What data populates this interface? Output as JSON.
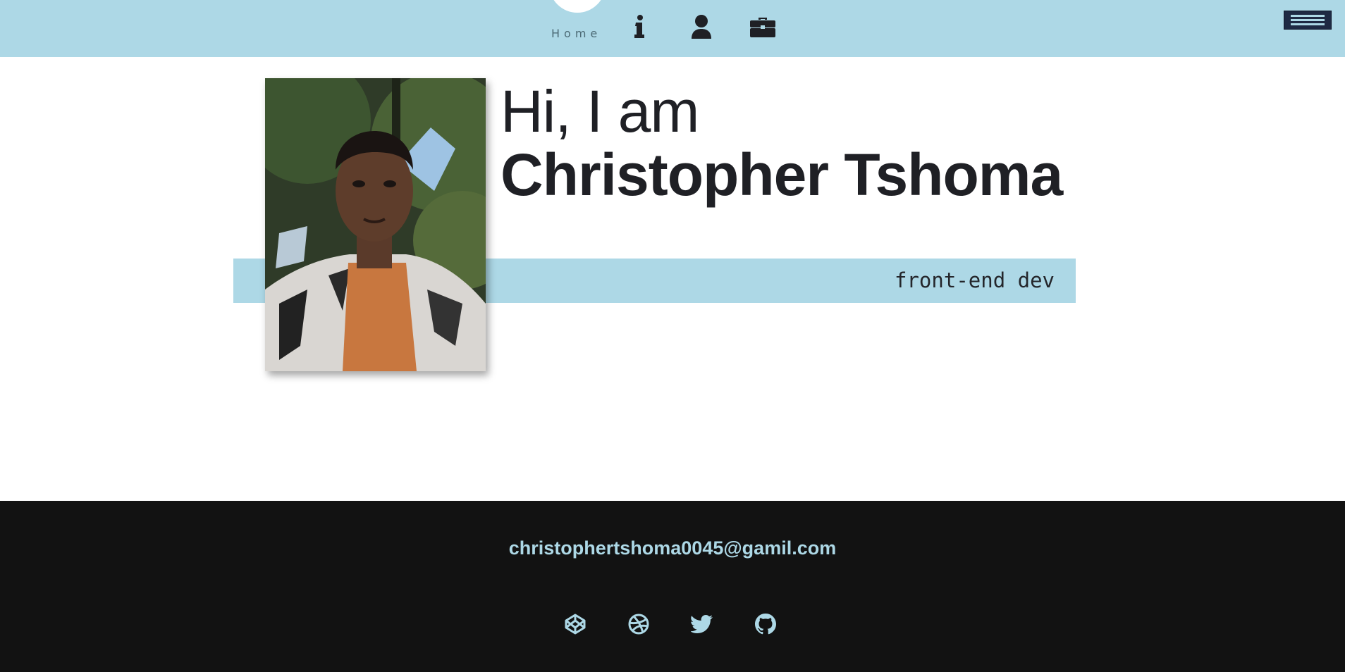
{
  "header": {
    "home_label": "Home",
    "icons": [
      "info-icon",
      "person-icon",
      "briefcase-icon",
      "hamburger-menu-icon"
    ]
  },
  "hero": {
    "greeting": "Hi, I am",
    "name": "Christopher Tshoma",
    "role": "front-end dev",
    "portrait_icon": "portrait-photo"
  },
  "footer": {
    "email": "christophertshoma0045@gamil.com",
    "social": [
      "codepen-icon",
      "dribbble-icon",
      "twitter-icon",
      "github-icon"
    ]
  },
  "colors": {
    "accent": "#add8e6",
    "text": "#1f2025",
    "footer_bg": "#121212"
  }
}
